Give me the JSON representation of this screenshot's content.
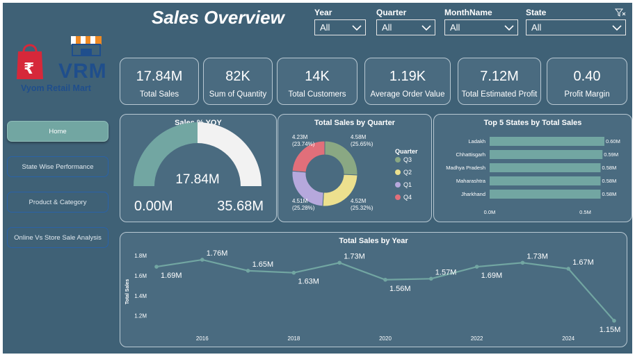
{
  "header": {
    "title": "Sales Overview"
  },
  "filters": [
    {
      "label": "Year",
      "value": "All"
    },
    {
      "label": "Quarter",
      "value": "All"
    },
    {
      "label": "MonthName",
      "value": "All"
    },
    {
      "label": "State",
      "value": "All"
    }
  ],
  "logo": {
    "brand": "VRM",
    "name": "Vyom Retail Mart"
  },
  "nav": [
    {
      "label": "Home",
      "active": true
    },
    {
      "label": "State Wise Performance",
      "active": false
    },
    {
      "label": "Product & Category",
      "active": false
    },
    {
      "label": "Online Vs Store Sale Analysis",
      "active": false
    }
  ],
  "kpis": [
    {
      "value": "17.84M",
      "label": "Total Sales"
    },
    {
      "value": "82K",
      "label": "Sum of Quantity"
    },
    {
      "value": "14K",
      "label": "Total Customers"
    },
    {
      "value": "1.19K",
      "label": "Average Order Value"
    },
    {
      "value": "7.12M",
      "label": "Total Estimated Profit"
    },
    {
      "value": "0.40",
      "label": "Profit Margin"
    }
  ],
  "colors": {
    "background": "#3f6176",
    "panel": "#4a6b80",
    "accent": "#72a6a2",
    "gauge_remainder": "#f2f2f2"
  },
  "chart_data": [
    {
      "type": "gauge",
      "title": "Sales % YOY",
      "value": 17.84,
      "value_label": "17.84M",
      "min": 0,
      "min_label": "0.00M",
      "max": 35.68,
      "max_label": "35.68M"
    },
    {
      "type": "pie",
      "title": "Total Sales by Quarter",
      "legend_title": "Quarter",
      "legend_position": "right",
      "slices": [
        {
          "name": "Q3",
          "value": 4.58,
          "label": "4.58M",
          "pct": "(25.65%)",
          "color": "#8aa883"
        },
        {
          "name": "Q2",
          "value": 4.52,
          "label": "4.52M",
          "pct": "(25.32%)",
          "color": "#ece08e"
        },
        {
          "name": "Q1",
          "value": 4.51,
          "label": "4.51M",
          "pct": "(25.28%)",
          "color": "#b6a8dc"
        },
        {
          "name": "Q4",
          "value": 4.23,
          "label": "4.23M",
          "pct": "(23.74%)",
          "color": "#e16f7a"
        }
      ]
    },
    {
      "type": "bar",
      "title": "Top 5 States by Total Sales",
      "orientation": "horizontal",
      "categories": [
        "Ladakh",
        "Chhattisgarh",
        "Madhya Pradesh",
        "Maharashtra",
        "Jharkhand"
      ],
      "values": [
        0.6,
        0.59,
        0.58,
        0.58,
        0.58
      ],
      "value_labels": [
        "0.60M",
        "0.59M",
        "0.58M",
        "0.58M",
        "0.58M"
      ],
      "xticks": [
        "0.0M",
        "0.5M"
      ],
      "xlim": [
        0,
        0.6
      ],
      "color": "#72a6a2"
    },
    {
      "type": "line",
      "title": "Total Sales by Year",
      "ylabel": "Total Sales",
      "x": [
        2015,
        2016,
        2017,
        2018,
        2019,
        2020,
        2021,
        2022,
        2023,
        2024,
        2025
      ],
      "values": [
        1.69,
        1.76,
        1.65,
        1.63,
        1.73,
        1.56,
        1.57,
        1.69,
        1.73,
        1.67,
        1.15
      ],
      "value_labels": [
        "1.69M",
        "1.76M",
        "1.65M",
        "1.63M",
        "1.73M",
        "1.56M",
        "1.57M",
        "1.69M",
        "1.73M",
        "1.67M",
        "1.15M"
      ],
      "xticks": [
        "2016",
        "2018",
        "2020",
        "2022",
        "2024"
      ],
      "yticks": [
        "1.2M",
        "1.4M",
        "1.6M",
        "1.8M"
      ],
      "ylim": [
        1.1,
        1.85
      ],
      "color": "#72a6a2"
    }
  ]
}
